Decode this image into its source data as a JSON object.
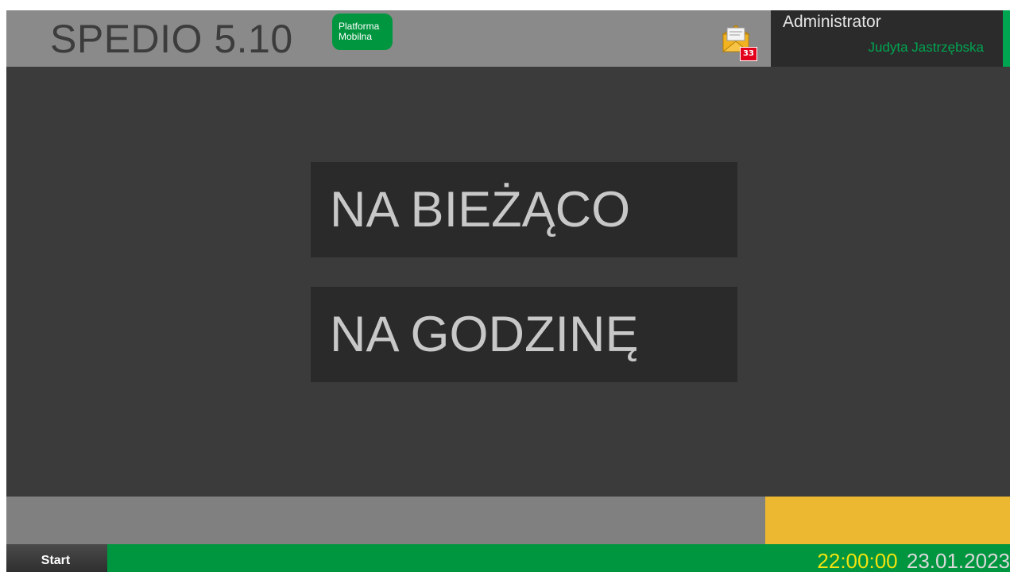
{
  "header": {
    "app_title": "SPEDIO 5.10",
    "badge_line1": "Platforma",
    "badge_line2": "Mobilna",
    "mail_count": "33",
    "mail_icon": "envelope-icon",
    "role": "Administrator",
    "username": "Judyta Jastrzębska"
  },
  "main": {
    "buttons": [
      {
        "label": "NA BIEŻĄCO"
      },
      {
        "label": "NA GODZINĘ"
      }
    ]
  },
  "taskbar": {
    "start_label": "Start",
    "time": "22:00:00",
    "date": "23.01.2023"
  },
  "colors": {
    "header_bg": "#8a8a8a",
    "main_bg": "#3b3b3b",
    "accent_green": "#00963f",
    "status_yellow": "#ecb731",
    "clock_yellow": "#f2e30e"
  }
}
